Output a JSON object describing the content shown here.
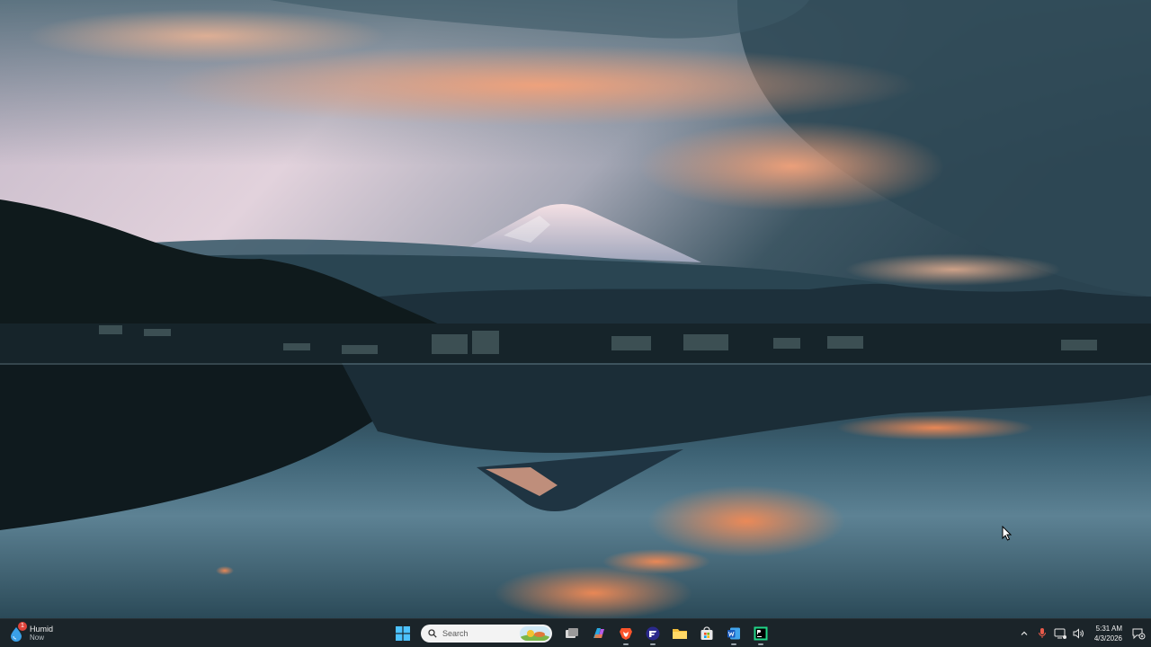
{
  "desktop": {
    "wallpaper": "Mount Fuji at dawn reflected in lake",
    "colors": {
      "sky_top": "#3b5b68",
      "sky_glow": "#f0a37a",
      "water": "#2d4a58",
      "taskbar": "#1c242a"
    }
  },
  "taskbar": {
    "weather": {
      "condition": "Humid",
      "time": "Now",
      "badge": "1"
    },
    "search": {
      "placeholder": "Search"
    },
    "apps": [
      {
        "name": "Start",
        "icon": "windows-logo-icon"
      },
      {
        "name": "Task View",
        "icon": "task-view-icon"
      },
      {
        "name": "Copilot",
        "icon": "copilot-icon"
      },
      {
        "name": "Brave",
        "icon": "brave-icon"
      },
      {
        "name": "Fenrir",
        "icon": "fenrir-icon"
      },
      {
        "name": "File Explorer",
        "icon": "folder-icon"
      },
      {
        "name": "Microsoft Store",
        "icon": "store-icon"
      },
      {
        "name": "Word",
        "icon": "word-icon"
      },
      {
        "name": "PyCharm",
        "icon": "pycharm-icon"
      }
    ],
    "tray": {
      "time": "5:31 AM",
      "date": "4/3/2026"
    }
  }
}
